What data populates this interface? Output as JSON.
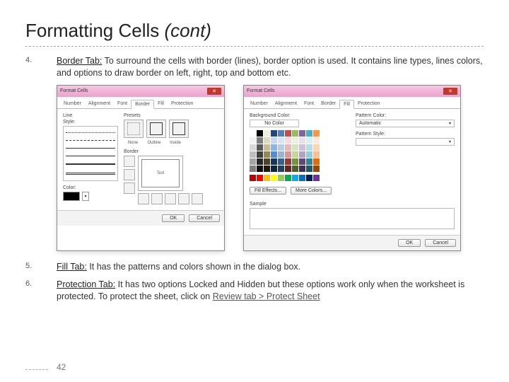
{
  "title_main": "Formatting Cells ",
  "title_cont": "(cont)",
  "items": [
    {
      "num": "4.",
      "label": "Border Tab:",
      "text": " To surround the cells with border (lines), border option is used. It contains line types, lines colors, and options to draw border on left, right, top and bottom etc."
    },
    {
      "num": "5.",
      "label": "Fill Tab:",
      "text": " It has the patterns and colors shown in the dialog box."
    },
    {
      "num": "6.",
      "label": "Protection Tab:",
      "text": "  It has two options Locked and Hidden but these options work only when the worksheet is protected. To protect the sheet, click on ",
      "link": "Review tab > Protect Sheet"
    }
  ],
  "dialog": {
    "title": "Format Cells",
    "tabs": [
      "Number",
      "Alignment",
      "Font",
      "Border",
      "Fill",
      "Protection"
    ],
    "border": {
      "line_label": "Line",
      "style_label": "Style:",
      "color_label": "Color:",
      "presets_label": "Presets",
      "preset_names": [
        "None",
        "Outline",
        "Inside"
      ],
      "border_label": "Border",
      "text_label": "Text"
    },
    "fill": {
      "bg_label": "Background Color:",
      "nocolor": "No Color",
      "pattern_color_label": "Pattern Color:",
      "automatic": "Automatic",
      "pattern_style_label": "Pattern Style:",
      "effects_btn": "Fill Effects...",
      "more_btn": "More Colors...",
      "sample_label": "Sample"
    },
    "ok": "OK",
    "cancel": "Cancel"
  },
  "page_number": "42",
  "palette": {
    "theme": [
      [
        "#ffffff",
        "#000000",
        "#eeece1",
        "#1f497d",
        "#4f81bd",
        "#c0504d",
        "#9bbb59",
        "#8064a2",
        "#4bacc6",
        "#f79646"
      ],
      [
        "#f2f2f2",
        "#7f7f7f",
        "#ddd9c3",
        "#c6d9f0",
        "#dbe5f1",
        "#f2dcdb",
        "#ebf1dd",
        "#e5e0ec",
        "#dbeef3",
        "#fdeada"
      ],
      [
        "#d8d8d8",
        "#595959",
        "#c4bd97",
        "#8db3e2",
        "#b8cce4",
        "#e5b9b7",
        "#d7e3bc",
        "#ccc1d9",
        "#b7dde8",
        "#fbd5b5"
      ],
      [
        "#bfbfbf",
        "#3f3f3f",
        "#938953",
        "#548dd4",
        "#95b3d7",
        "#d99694",
        "#c3d69b",
        "#b2a2c7",
        "#92cddc",
        "#fac08f"
      ],
      [
        "#a5a5a5",
        "#262626",
        "#494429",
        "#17365d",
        "#366092",
        "#953734",
        "#76923c",
        "#5f497a",
        "#31859b",
        "#e36c09"
      ],
      [
        "#7f7f7f",
        "#0c0c0c",
        "#1d1b10",
        "#0f243e",
        "#244061",
        "#632423",
        "#4f6128",
        "#3f3151",
        "#205867",
        "#974806"
      ]
    ],
    "standard": [
      "#c00000",
      "#ff0000",
      "#ffc000",
      "#ffff00",
      "#92d050",
      "#00b050",
      "#00b0f0",
      "#0070c0",
      "#002060",
      "#7030a0"
    ]
  }
}
